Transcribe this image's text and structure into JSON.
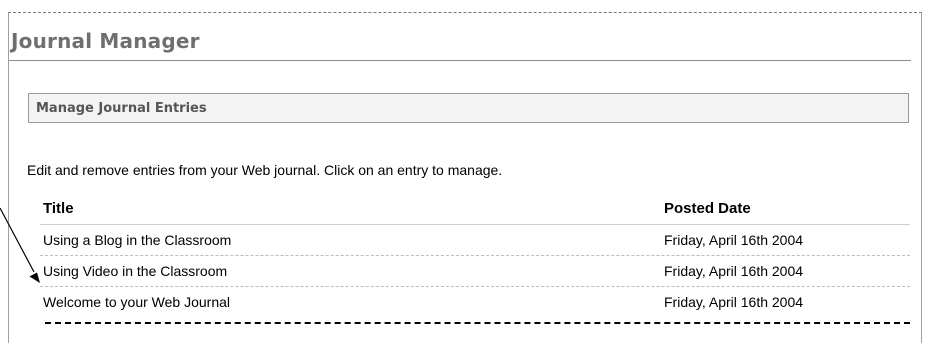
{
  "page": {
    "title": "Journal Manager"
  },
  "section": {
    "title": "Manage Journal Entries"
  },
  "description": "Edit and remove entries from your Web journal. Click on an entry to manage.",
  "table": {
    "columns": [
      "Title",
      "Posted Date"
    ],
    "rows": [
      {
        "title": "Using a Blog in the Classroom",
        "date": "Friday, April 16th 2004"
      },
      {
        "title": "Using Video in the Classroom",
        "date": "Friday, April 16th 2004"
      },
      {
        "title": "Welcome to your Web Journal",
        "date": "Friday, April 16th 2004"
      }
    ]
  },
  "colors": {
    "title_gray": "#6f6f6f",
    "section_bg": "#f3f3f3",
    "section_border": "#9a9a9a"
  }
}
